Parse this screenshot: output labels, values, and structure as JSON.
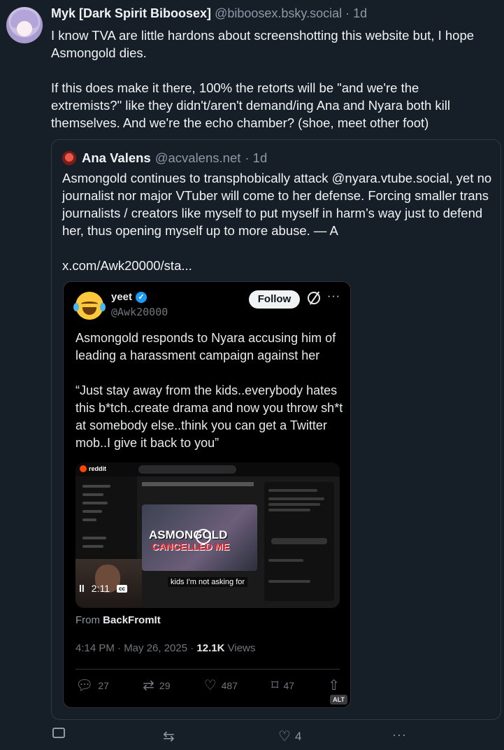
{
  "post": {
    "author_name": "Myk [Dark Spirit Biboosex]",
    "author_handle": "@biboosex.bsky.social",
    "timestamp": "· 1d",
    "paragraphs": [
      "I know TVA are little hardons about screenshotting this website but, I hope Asmongold dies.",
      "If this does make it there, 100% the retorts will be \"and we're the extremists?\" like they didn't/aren't demand/ing Ana and Nyara both kill themselves. And we're the echo chamber? (shoe, meet other foot)"
    ]
  },
  "quote": {
    "author_name": "Ana Valens",
    "author_handle": "@acvalens.net",
    "timestamp": "· 1d",
    "paragraphs": [
      "Asmongold continues to transphobically attack @nyara.vtube.social, yet no journalist nor major VTuber will come to her defense. Forcing smaller trans journalists / creators like myself to put myself in harm’s way just to defend her, thus opening myself up to more abuse. — A",
      "x.com/Awk20000/sta..."
    ]
  },
  "embed": {
    "display_name": "yeet",
    "handle": "@Awk20000",
    "follow_label": "Follow",
    "more_label": "···",
    "paragraphs": [
      "Asmongold responds to Nyara accusing him of leading a harassment campaign against her",
      "“Just stay away from the kids..everybody hates this b*tch..create drama and now you throw sh*t at somebody else..think you can get a Twitter mob..I give it back to you”"
    ],
    "video": {
      "site_label": "reddit",
      "thumb_title": "ASMONGOLD",
      "thumb_subtitle": "CANCELLED ME",
      "time": "2:11",
      "pause_icon": "ll",
      "cc_label": "cc",
      "caption": "kids I'm not asking for"
    },
    "from_prefix": "From",
    "from_source": "BackFromIt",
    "time_date": "4:14 PM · May 26, 2025 ·",
    "views_count": "12.1K",
    "views_label": "Views",
    "reply_count": "27",
    "retweet_count": "29",
    "like_count": "487",
    "bookmark_count": "47",
    "alt_label": "ALT"
  },
  "footer": {
    "like_count": "4",
    "more_label": "···"
  }
}
